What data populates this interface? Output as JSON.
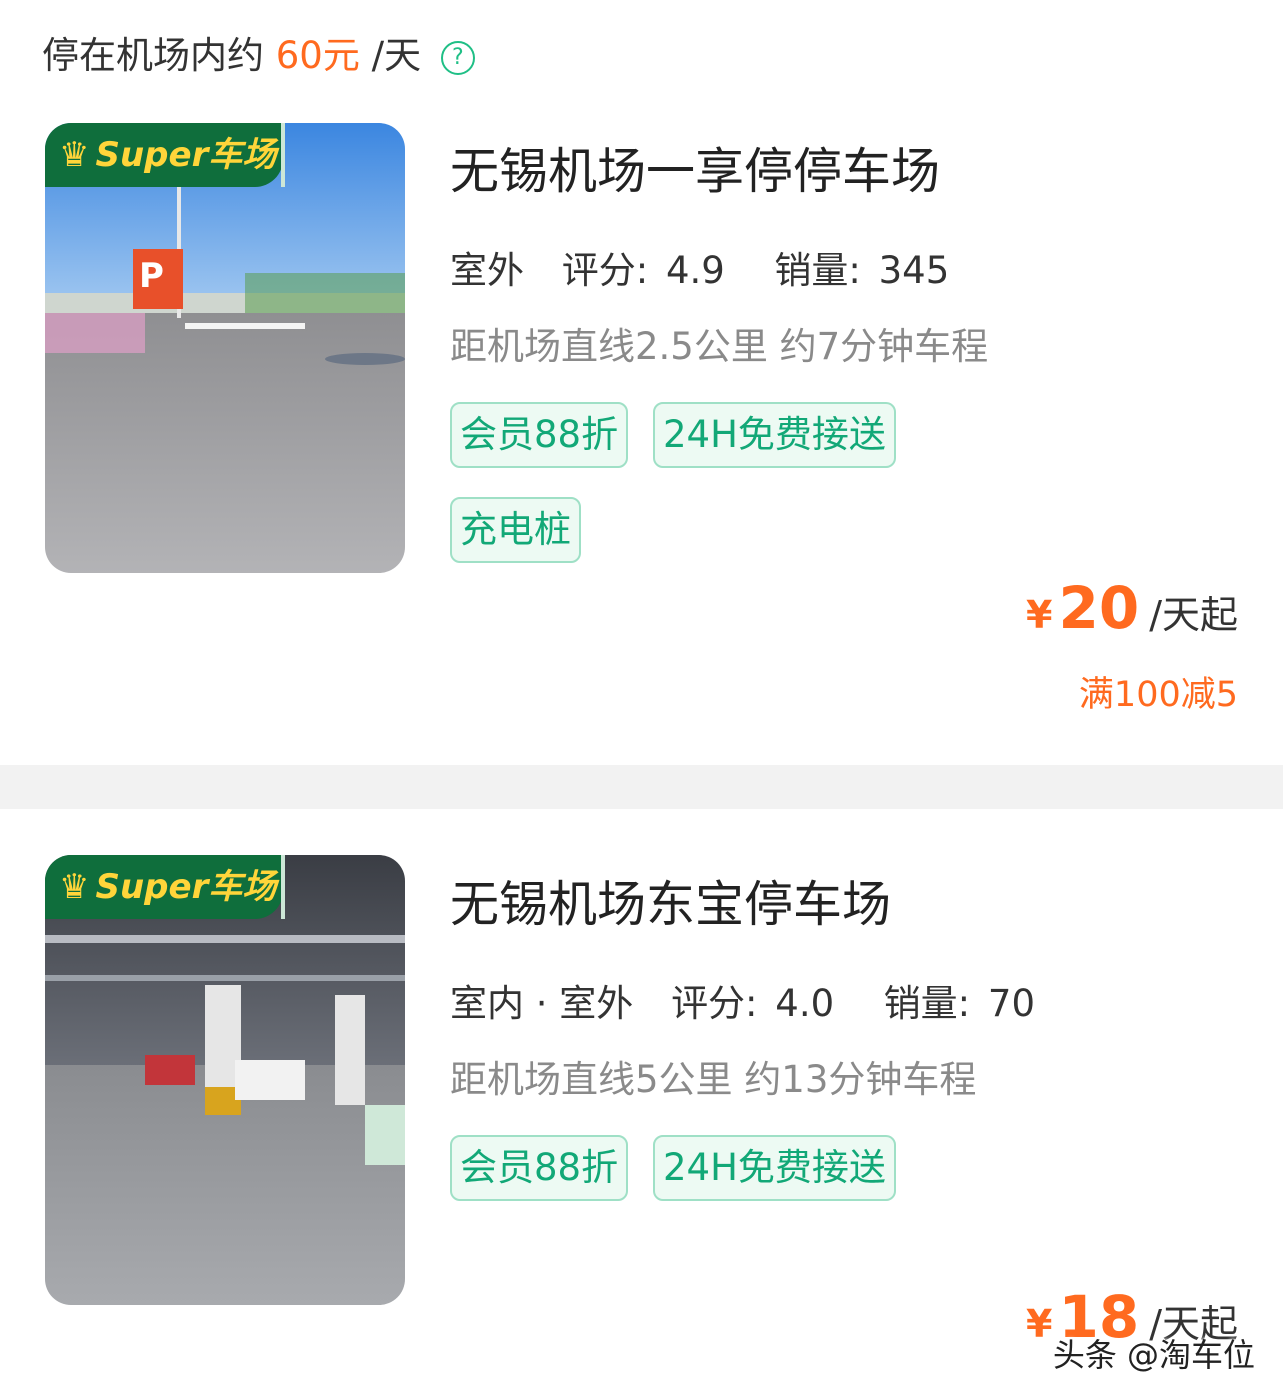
{
  "header": {
    "prefix": "停在机场内约",
    "price": "60元",
    "suffix": "/天",
    "help_icon": "question-circle-icon"
  },
  "badge": {
    "crown_icon": "crown-icon",
    "text": "Super车场"
  },
  "lots": [
    {
      "name": "无锡机场一享停停车场",
      "env": "室外",
      "rating_label": "评分:",
      "rating": "4.9",
      "sales_label": "销量:",
      "sales": "345",
      "distance": "距机场直线2.5公里 约7分钟车程",
      "tags": [
        "会员88折",
        "24H免费接送",
        "充电桩"
      ],
      "currency": "¥",
      "price": "20",
      "price_unit": "/天起",
      "promo": "满100减5",
      "photo_sign": "P"
    },
    {
      "name": "无锡机场东宝停车场",
      "env": "室内 · 室外",
      "rating_label": "评分:",
      "rating": "4.0",
      "sales_label": "销量:",
      "sales": "70",
      "distance": "距机场直线5公里 约13分钟车程",
      "tags": [
        "会员88折",
        "24H免费接送"
      ],
      "currency": "¥",
      "price": "18",
      "price_unit": "/天起"
    }
  ],
  "watermark": "头条 @淘车位",
  "colors": {
    "accent": "#ff6a1f",
    "green": "#12a877",
    "badge_bg": "#0f6e3c",
    "badge_text": "#ffd53a"
  }
}
